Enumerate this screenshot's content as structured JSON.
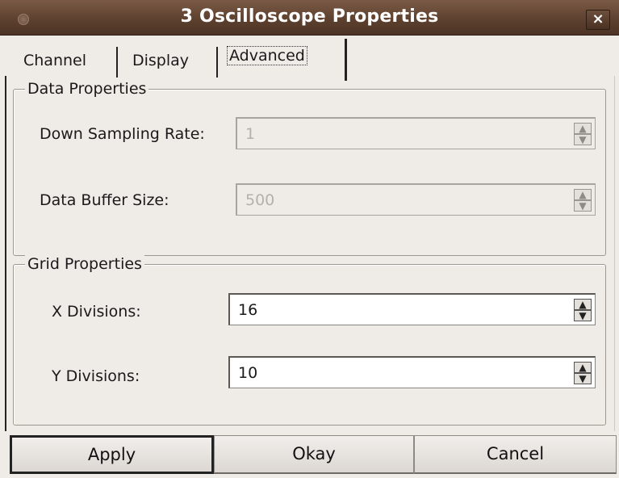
{
  "window": {
    "title": "3 Oscilloscope Properties",
    "close_glyph": "×"
  },
  "tabs": [
    {
      "label": "Channel"
    },
    {
      "label": "Display"
    },
    {
      "label": "Advanced",
      "selected": true
    }
  ],
  "data_properties": {
    "legend": "Data Properties",
    "down_sampling_rate": {
      "label": "Down Sampling Rate:",
      "value": "1",
      "enabled": false
    },
    "data_buffer_size": {
      "label": "Data Buffer Size:",
      "value": "500",
      "enabled": false
    }
  },
  "grid_properties": {
    "legend": "Grid Properties",
    "x_divisions": {
      "label": "X Divisions:",
      "value": "16",
      "enabled": true
    },
    "y_divisions": {
      "label": "Y Divisions:",
      "value": "10",
      "enabled": true
    }
  },
  "buttons": {
    "apply": "Apply",
    "okay": "Okay",
    "cancel": "Cancel"
  },
  "icons": {
    "spin_up": "▲",
    "spin_down": "▼"
  }
}
